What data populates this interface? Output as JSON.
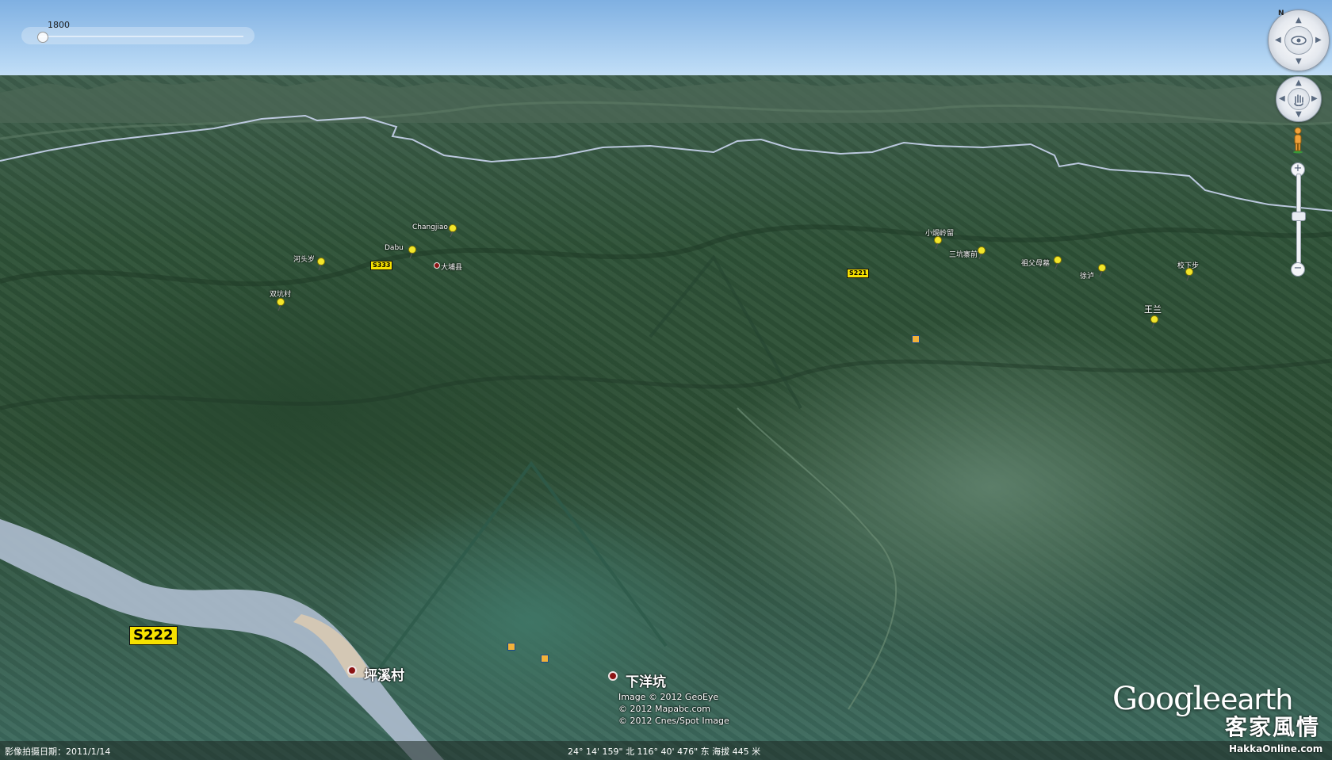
{
  "viewer": {
    "time_slider": {
      "label": "1800"
    },
    "navigation": {
      "north_letter": "N",
      "zoom_in": "+",
      "zoom_out": "−"
    }
  },
  "map_labels": {
    "places_small": [
      {
        "id": "changjiao",
        "text": "Changjiao"
      },
      {
        "id": "dabu",
        "text": "Dabu"
      },
      {
        "id": "hetoulun",
        "text": "河头岁"
      },
      {
        "id": "dapuxian",
        "text": "大埔县"
      },
      {
        "id": "shuangkengcun",
        "text": "双坑村"
      },
      {
        "id": "xiaojiaoding",
        "text": "小焗岭留"
      },
      {
        "id": "shanlupu",
        "text": "三坑寨前"
      },
      {
        "id": "muzumu",
        "text": "祖父母墓"
      },
      {
        "id": "xuhu",
        "text": "徐泸"
      },
      {
        "id": "jiaoxiabu",
        "text": "校下步"
      },
      {
        "id": "wangsan",
        "text": "王兰"
      }
    ],
    "places_large": [
      {
        "id": "pingxicun",
        "text": "坪溪村"
      },
      {
        "id": "xiayangkeng",
        "text": "下洋坑"
      }
    ],
    "road_shields": [
      {
        "id": "s333",
        "text": "S333"
      },
      {
        "id": "s221",
        "text": "S221"
      },
      {
        "id": "s222",
        "text": "S222"
      }
    ]
  },
  "copyright": {
    "line1": "Image © 2012 GeoEye",
    "line2": "© 2012 Mapabc.com",
    "line3": "© 2012 Cnes/Spot Image"
  },
  "status_bar": {
    "imagery_date": "影像拍摄日期：2011/1/14",
    "coordinates": "24° 14' 159\" 北  116° 40' 476\" 东  海拔  445 米"
  },
  "branding": {
    "logo_google": "Google",
    "logo_earth": "earth",
    "watermark_text": "客家風情",
    "watermark_url": "HakkaOnline.com"
  },
  "colors": {
    "pin": "#f2e62b",
    "shield": "#f6e200",
    "poi_dot": "#8b1414",
    "river": "#a9b8c9",
    "border_line": "#c9d4ee"
  }
}
